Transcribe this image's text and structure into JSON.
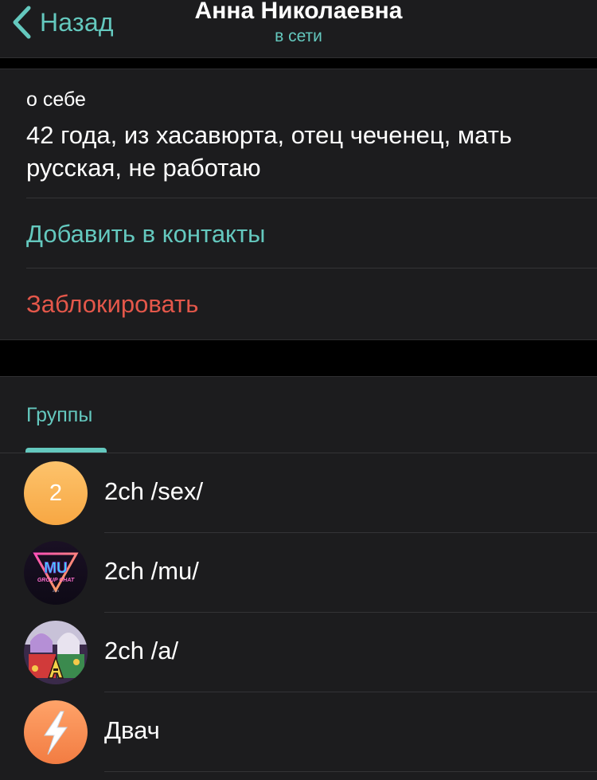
{
  "nav": {
    "back_label": "Назад",
    "title": "Анна Николаевна",
    "status": "в сети"
  },
  "profile": {
    "about_label": "о себе",
    "about_text": "42 года, из хасавюрта, отец чеченец, мать русская, не работаю",
    "add_contact_label": "Добавить в контакты",
    "block_label": "Заблокировать"
  },
  "groups": {
    "tab_label": "Группы",
    "items": [
      {
        "title": "2ch /sex/",
        "avatar_text": "2",
        "avatar": "letter-avatar"
      },
      {
        "title": "2ch /mu/",
        "avatar": "mu-group-chat-logo"
      },
      {
        "title": "2ch /a/",
        "avatar": "anime-collage-image"
      },
      {
        "title": "Двач",
        "avatar": "lightning-icon"
      }
    ]
  },
  "colors": {
    "accent": "#64c8be",
    "destructive": "#e4574a",
    "background": "#000000",
    "panel": "#1c1c1e",
    "text": "#ffffff"
  }
}
